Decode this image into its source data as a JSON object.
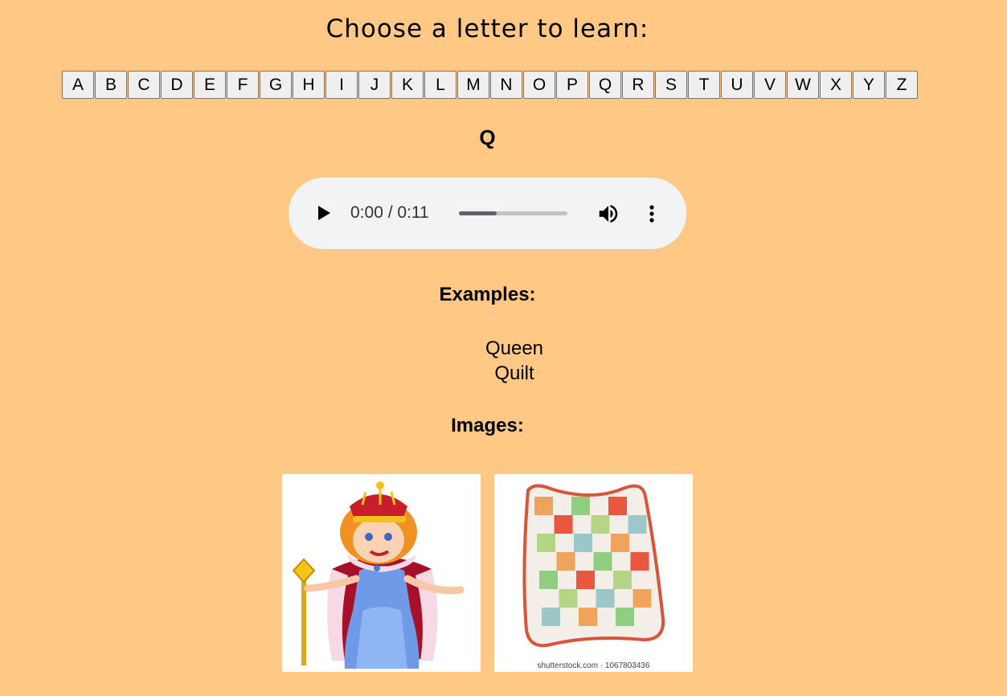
{
  "title": "Choose a letter to learn:",
  "letters": [
    "A",
    "B",
    "C",
    "D",
    "E",
    "F",
    "G",
    "H",
    "I",
    "J",
    "K",
    "L",
    "M",
    "N",
    "O",
    "P",
    "Q",
    "R",
    "S",
    "T",
    "U",
    "V",
    "W",
    "X",
    "Y",
    "Z"
  ],
  "selected_letter": "Q",
  "audio": {
    "time": "0:00 / 0:11",
    "progress_fraction": 0.35,
    "play_icon": "play-icon",
    "volume_icon": "volume-icon",
    "menu_icon": "more-vertical-icon"
  },
  "examples": {
    "heading": "Examples:",
    "items": [
      "Queen",
      "Quilt"
    ]
  },
  "images": {
    "heading": "Images:",
    "queen_alt": "Queen",
    "quilt_alt": "Quilt",
    "quilt_watermark": "shutterstock.com · 1067803436"
  },
  "colors": {
    "background": "#ffc985",
    "player_background": "#f1f3f4"
  }
}
